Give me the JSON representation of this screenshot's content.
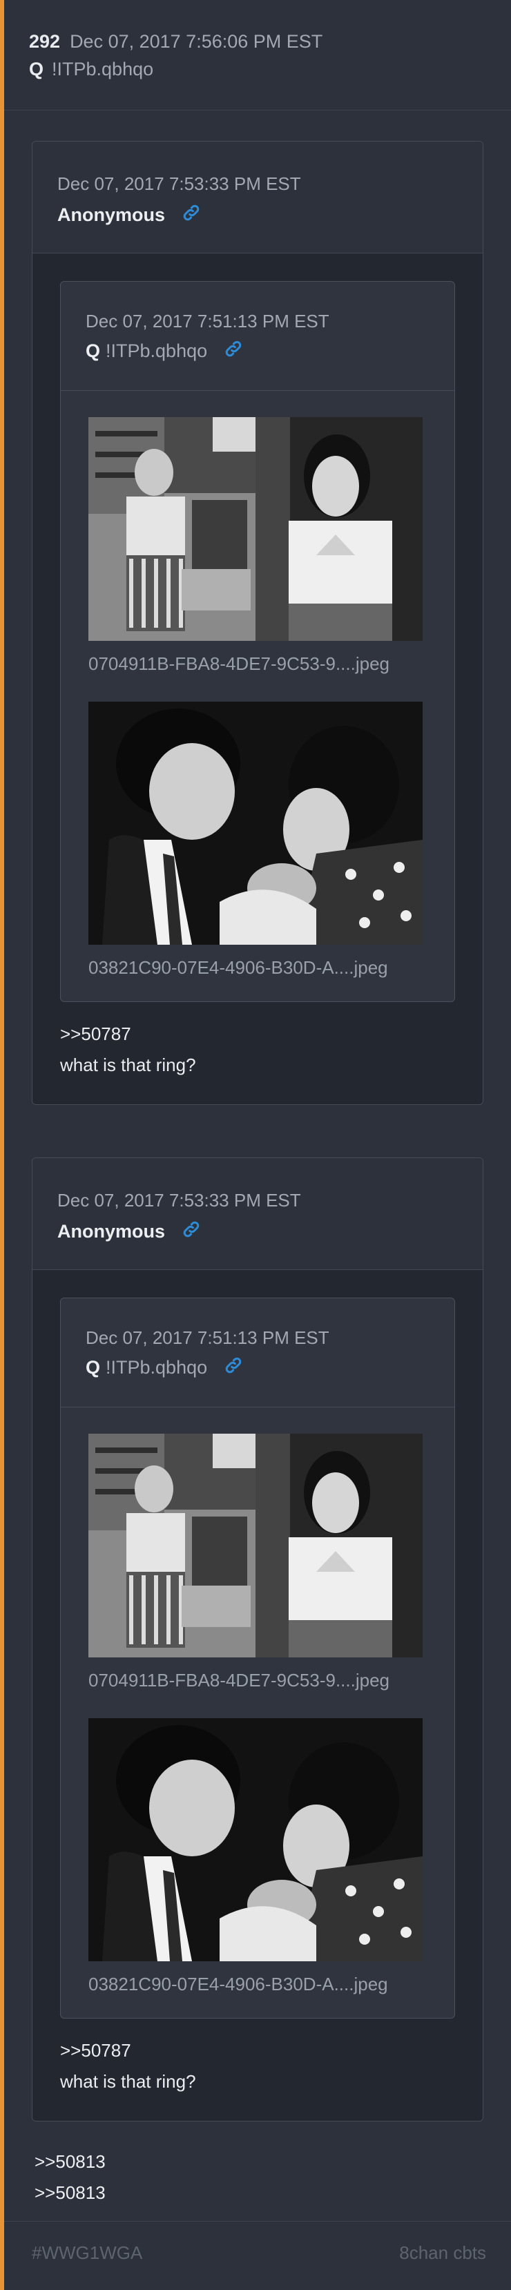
{
  "post": {
    "number": "292",
    "date": "Dec 07, 2017 7:56:06 PM EST",
    "name": "Q",
    "tripcode": "!ITPb.qbhqo"
  },
  "quotes": [
    {
      "date": "Dec 07, 2017 7:53:33 PM EST",
      "name": "Anonymous",
      "inner": {
        "date": "Dec 07, 2017 7:51:13 PM EST",
        "name": "Q",
        "tripcode": "!ITPb.qbhqo",
        "images": [
          {
            "filename": "0704911B-FBA8-4DE7-9C53-9....jpeg"
          },
          {
            "filename": "03821C90-07E4-4906-B30D-A....jpeg"
          }
        ]
      },
      "text": [
        ">>50787",
        "what is that ring?"
      ]
    },
    {
      "date": "Dec 07, 2017 7:53:33 PM EST",
      "name": "Anonymous",
      "inner": {
        "date": "Dec 07, 2017 7:51:13 PM EST",
        "name": "Q",
        "tripcode": "!ITPb.qbhqo",
        "images": [
          {
            "filename": "0704911B-FBA8-4DE7-9C53-9....jpeg"
          },
          {
            "filename": "03821C90-07E4-4906-B30D-A....jpeg"
          }
        ]
      },
      "text": [
        ">>50787",
        "what is that ring?"
      ]
    }
  ],
  "post_text": [
    ">>50813",
    ">>50813"
  ],
  "footer": {
    "hashtag": "#WWG1WGA",
    "source": "8chan cbts"
  },
  "colors": {
    "accent_border": "#e8923a",
    "link_icon": "#2e8bd6",
    "background": "#2c313b"
  },
  "icons": {
    "link": "link-icon"
  }
}
